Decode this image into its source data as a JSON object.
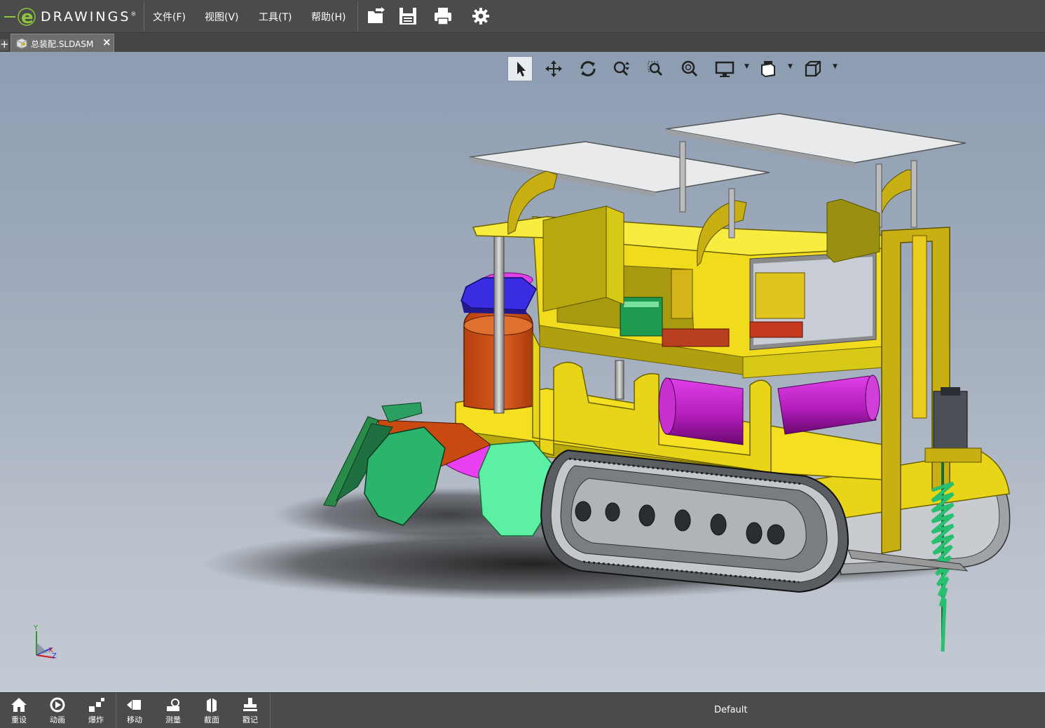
{
  "app": {
    "logo_text": "DRAWINGS",
    "logo_letter": "e",
    "logo_mark": "®"
  },
  "menu": [
    {
      "id": "file",
      "label": "文件(F)"
    },
    {
      "id": "view",
      "label": "视图(V)"
    },
    {
      "id": "tools",
      "label": "工具(T)"
    },
    {
      "id": "help",
      "label": "帮助(H)"
    }
  ],
  "toolbar_icons": [
    "open-icon",
    "save-icon",
    "print-icon",
    "gear-icon"
  ],
  "tab": {
    "label": "总装配.SLDASM",
    "close": "×",
    "new": "+"
  },
  "view_tools": [
    "select-arrow-icon",
    "pan-icon",
    "rotate-icon",
    "zoom-icon",
    "zoom-area-icon",
    "zoom-fit-icon",
    "display-style-icon",
    "view-orientation-icon",
    "standard-views-icon"
  ],
  "triad": {
    "x": "X",
    "y": "Y",
    "z": "Z"
  },
  "bottom_tools": [
    {
      "id": "reset",
      "label": "重设",
      "icon": "home-icon"
    },
    {
      "id": "animate",
      "label": "动画",
      "icon": "animate-icon"
    },
    {
      "id": "explode",
      "label": "爆炸",
      "icon": "explode-icon"
    },
    {
      "id": "move",
      "label": "移动",
      "icon": "move-icon"
    },
    {
      "id": "measure",
      "label": "测量",
      "icon": "measure-icon"
    },
    {
      "id": "section",
      "label": "截面",
      "icon": "section-icon"
    },
    {
      "id": "stamp",
      "label": "戳记",
      "icon": "stamp-icon"
    }
  ],
  "configuration": "Default",
  "colors": {
    "frame_yellow": "#e8d418",
    "frame_dark": "#a89a10",
    "track_gray": "#b8bcc0",
    "tank_magenta": "#b41ebc",
    "drum_orange": "#c8501c",
    "green_cutter": "#2cb46c",
    "mint": "#5cf0a4",
    "blue": "#3a2ce0",
    "panel_white": "#e8eaec",
    "bar_bg": "#4b4b4b"
  }
}
